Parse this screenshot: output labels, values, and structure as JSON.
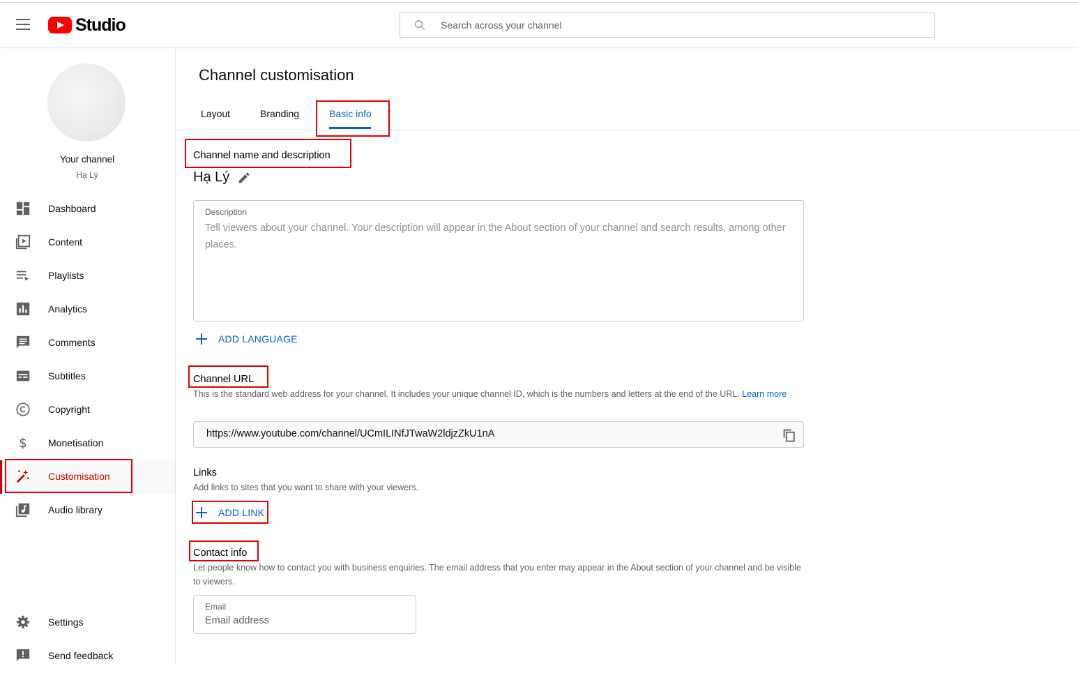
{
  "header": {
    "logo_text": "Studio",
    "search_placeholder": "Search across your channel"
  },
  "sidebar": {
    "channel_label": "Your channel",
    "channel_name": "Hạ Lý",
    "items": [
      {
        "label": "Dashboard",
        "icon": "dashboard-icon"
      },
      {
        "label": "Content",
        "icon": "content-icon"
      },
      {
        "label": "Playlists",
        "icon": "playlists-icon"
      },
      {
        "label": "Analytics",
        "icon": "analytics-icon"
      },
      {
        "label": "Comments",
        "icon": "comments-icon"
      },
      {
        "label": "Subtitles",
        "icon": "subtitles-icon"
      },
      {
        "label": "Copyright",
        "icon": "copyright-icon"
      },
      {
        "label": "Monetisation",
        "icon": "monetisation-icon"
      },
      {
        "label": "Customisation",
        "icon": "magic-wand-icon",
        "active": true
      },
      {
        "label": "Audio library",
        "icon": "audio-library-icon"
      }
    ],
    "bottom_items": [
      {
        "label": "Settings",
        "icon": "gear-icon"
      },
      {
        "label": "Send feedback",
        "icon": "feedback-icon"
      }
    ]
  },
  "main": {
    "title": "Channel customisation",
    "tabs": [
      {
        "label": "Layout"
      },
      {
        "label": "Branding"
      },
      {
        "label": "Basic info",
        "active": true
      }
    ],
    "name_section": {
      "title": "Channel name and description",
      "channel_name": "Hạ Lý",
      "description_label": "Description",
      "description_placeholder": "Tell viewers about your channel. Your description will appear in the About section of your channel and search results, among other places.",
      "add_language": "ADD LANGUAGE"
    },
    "url_section": {
      "title": "Channel URL",
      "description": "This is the standard web address for your channel. It includes your unique channel ID, which is the numbers and letters at the end of the URL.",
      "learn_more": "Learn more",
      "url": "https://www.youtube.com/channel/UCmILINfJTwaW2ldjzZkU1nA"
    },
    "links_section": {
      "title": "Links",
      "description": "Add links to sites that you want to share with your viewers.",
      "add_link": "ADD LINK"
    },
    "contact_section": {
      "title": "Contact info",
      "description": "Let people know how to contact you with business enquiries. The email address that you enter may appear in the About section of your channel and be visible to viewers.",
      "email_label": "Email",
      "email_placeholder": "Email address"
    }
  },
  "colors": {
    "brand_red": "#ff0000",
    "active_red": "#cc0000",
    "link_blue": "#065fd4",
    "highlight_box": "#e00000"
  }
}
